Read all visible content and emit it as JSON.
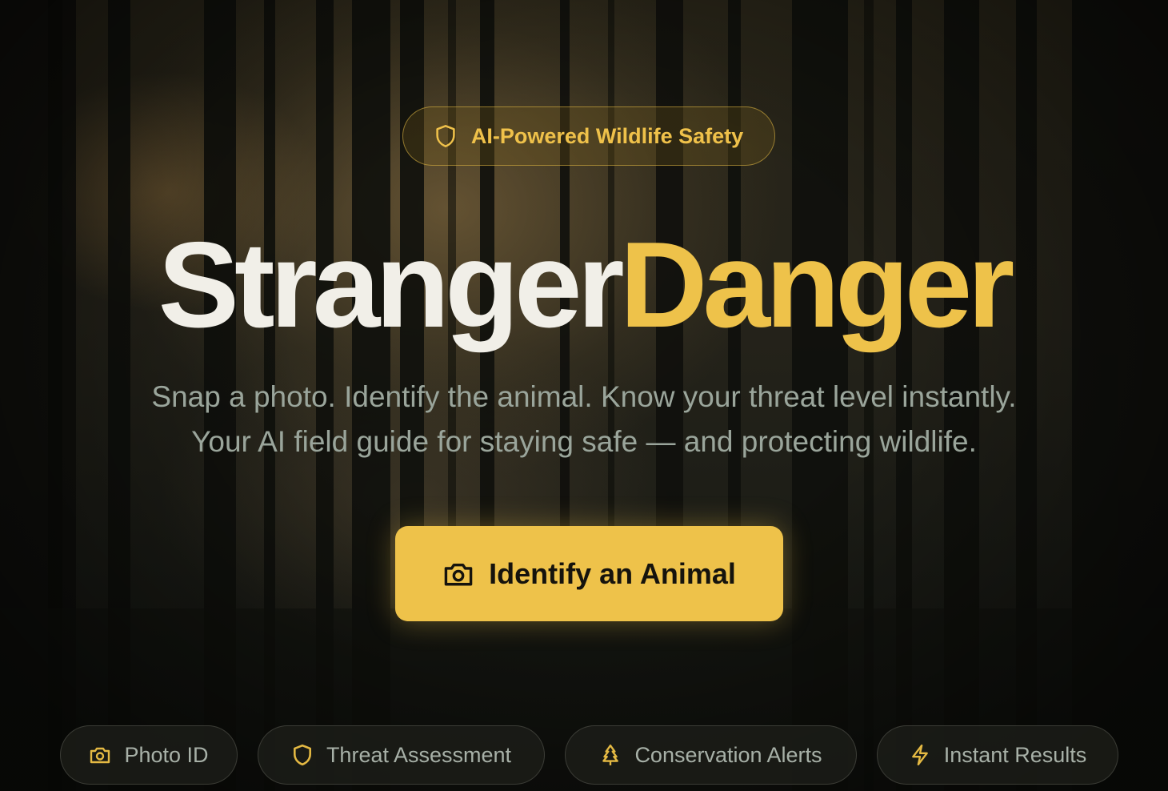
{
  "badge": {
    "icon": "shield-icon",
    "label": "AI-Powered Wildlife Safety"
  },
  "title": {
    "part1": "Stranger",
    "part2": "Danger"
  },
  "subtitle": {
    "line1": "Snap a photo. Identify the animal. Know your threat level instantly.",
    "line2": "Your AI field guide for staying safe — and protecting wildlife."
  },
  "cta": {
    "icon": "camera-icon",
    "label": "Identify an Animal"
  },
  "features": [
    {
      "icon": "camera-icon",
      "label": "Photo ID"
    },
    {
      "icon": "shield-icon",
      "label": "Threat Assessment"
    },
    {
      "icon": "tree-icon",
      "label": "Conservation Alerts"
    },
    {
      "icon": "lightning-icon",
      "label": "Instant Results"
    }
  ],
  "colors": {
    "accent": "#eec24a",
    "title_white": "#f1efe8",
    "muted_text": "#9aa59b",
    "background": "#151611"
  }
}
